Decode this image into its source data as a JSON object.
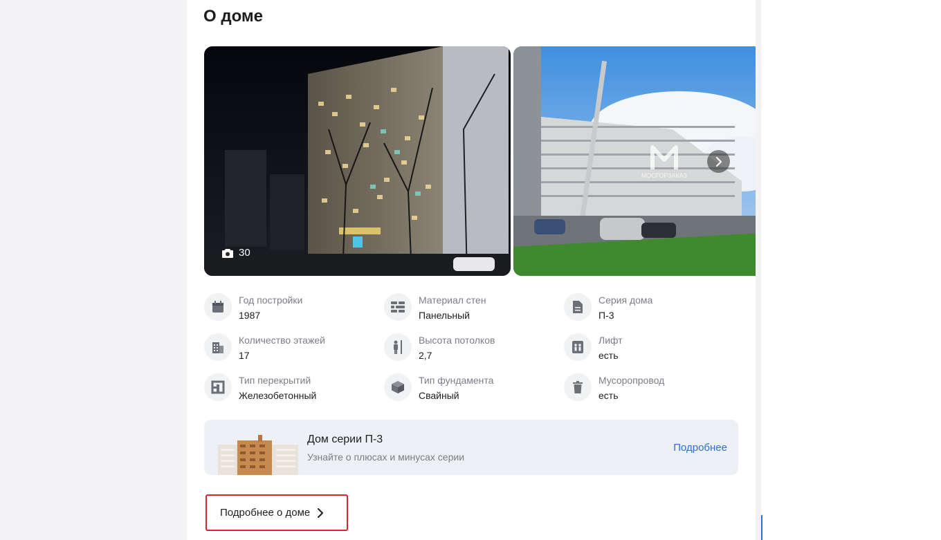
{
  "section": {
    "title": "О доме"
  },
  "gallery": {
    "photo_count": "30",
    "watermark_text": "МОСГОРЗАКАЗ",
    "icons": {
      "counter": "camera-icon",
      "next": "chevron-right-icon"
    }
  },
  "features": [
    {
      "icon": "calendar-icon",
      "label": "Год постройки",
      "value": "1987"
    },
    {
      "icon": "wall-bricks-icon",
      "label": "Материал стен",
      "value": "Панельный"
    },
    {
      "icon": "document-icon",
      "label": "Серия дома",
      "value": "П-3"
    },
    {
      "icon": "building-icon",
      "label": "Количество этажей",
      "value": "17"
    },
    {
      "icon": "ceiling-height-icon",
      "label": "Высота потолков",
      "value": "2,7"
    },
    {
      "icon": "elevator-icon",
      "label": "Лифт",
      "value": "есть"
    },
    {
      "icon": "floor-slab-icon",
      "label": "Тип перекрытий",
      "value": "Железобетонный"
    },
    {
      "icon": "foundation-cube-icon",
      "label": "Тип фундамента",
      "value": "Свайный"
    },
    {
      "icon": "trash-bin-icon",
      "label": "Мусоропровод",
      "value": "есть"
    }
  ],
  "series_banner": {
    "title": "Дом серии П-3",
    "subtitle": "Узнайте о плюсах и минусах серии",
    "link": "Подробнее"
  },
  "more_button": {
    "label": "Подробнее о доме",
    "icon": "chevron-right-icon"
  },
  "colors": {
    "accent": "#2b6fd6",
    "highlight_border": "#d9262e",
    "banner_bg": "#edf0f4"
  }
}
